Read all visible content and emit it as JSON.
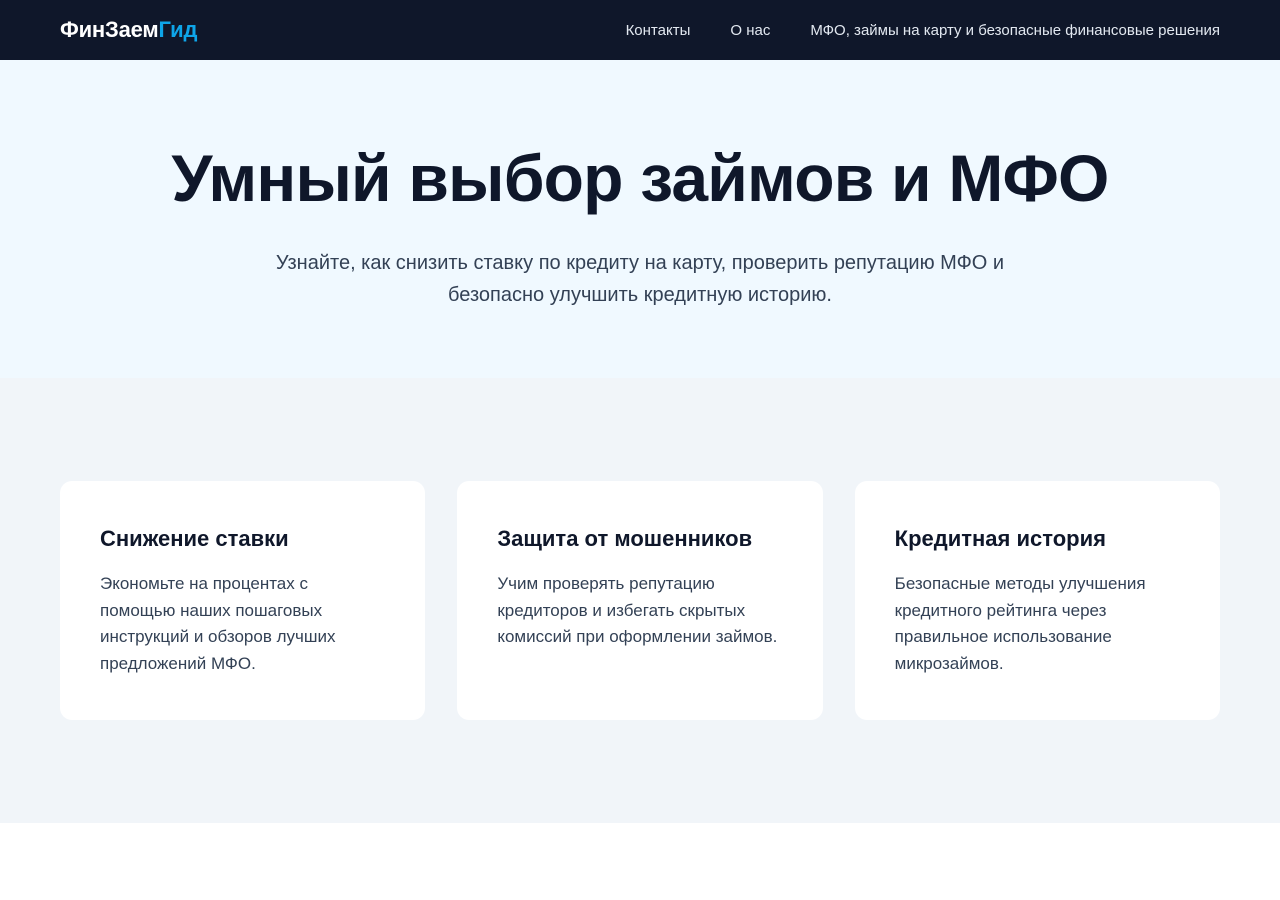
{
  "nav": {
    "logo_main": "ФинЗаем",
    "logo_accent": "Гид",
    "links": [
      "Контакты",
      "О нас",
      "МФО, займы на карту и безопасные финансовые решения"
    ]
  },
  "hero": {
    "title": "Умный выбор займов и МФО",
    "subtitle": "Узнайте, как снизить ставку по кредиту на карту, проверить репутацию МФО и безопасно улучшить кредитную историю."
  },
  "features": [
    {
      "title": "Снижение ставки",
      "text": "Экономьте на процентах с помощью наших пошаговых инструкций и обзоров лучших предложений МФО."
    },
    {
      "title": "Защита от мошенников",
      "text": "Учим проверять репутацию кредиторов и избегать скрытых комиссий при оформлении займов."
    },
    {
      "title": "Кредитная история",
      "text": "Безопасные методы улучшения кредитного рейтинга через правильное использование микрозаймов."
    }
  ],
  "colors": {
    "nav_bg": "#0f172a",
    "accent": "#0ea5e9",
    "hero_bg": "#f0f9ff",
    "features_bg": "#f1f5f9"
  }
}
